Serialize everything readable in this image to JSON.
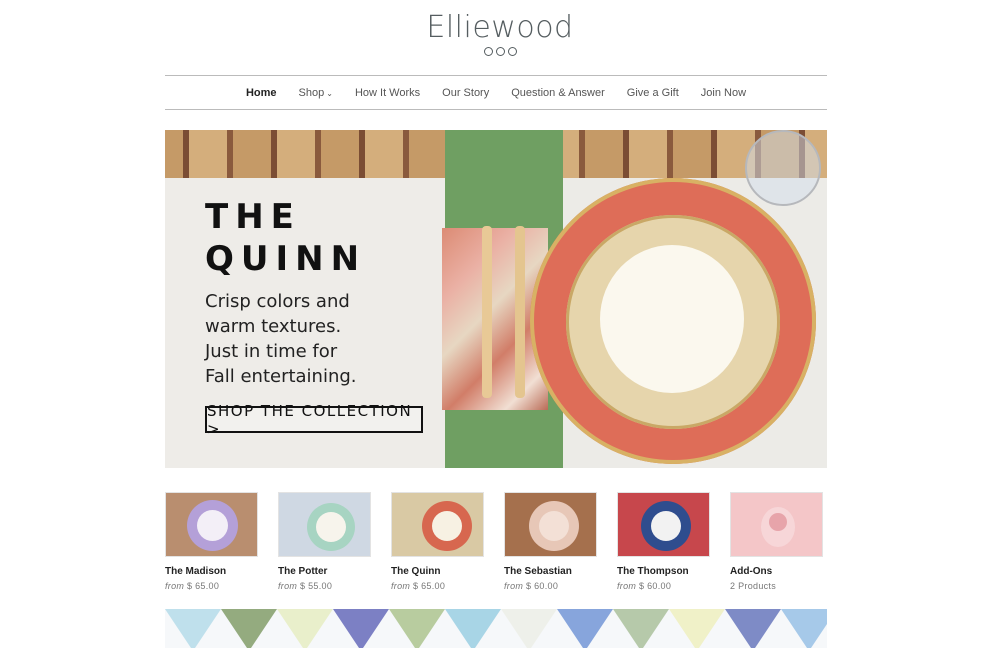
{
  "brand": {
    "name": "Elliewood"
  },
  "nav": {
    "items": [
      {
        "label": "Home",
        "active": true
      },
      {
        "label": "Shop",
        "dropdown": true
      },
      {
        "label": "How It Works"
      },
      {
        "label": "Our Story"
      },
      {
        "label": "Question & Answer"
      },
      {
        "label": "Give a Gift"
      },
      {
        "label": "Join Now"
      }
    ]
  },
  "hero": {
    "title_line1": "THE",
    "title_line2": "QUINN",
    "tagline_line1": "Crisp colors and",
    "tagline_line2": "warm textures.",
    "tagline_line3": "Just in time for",
    "tagline_line4": "Fall entertaining.",
    "cta": "SHOP THE COLLECTION >"
  },
  "products": [
    {
      "name": "The Madison",
      "from": "from",
      "price": "$ 65.00",
      "colors": {
        "bg": "#b98e6f",
        "plate": "#b4a0d8",
        "inner": "#f3eff7"
      }
    },
    {
      "name": "The Potter",
      "from": "from",
      "price": "$ 55.00",
      "colors": {
        "bg": "#cfd8e3",
        "plate": "#a7d4c2",
        "inner": "#f7f4ec"
      }
    },
    {
      "name": "The Quinn",
      "from": "from",
      "price": "$ 65.00",
      "colors": {
        "bg": "#d9c9a4",
        "plate": "#d7674f",
        "inner": "#f7f1e3"
      }
    },
    {
      "name": "The Sebastian",
      "from": "from",
      "price": "$ 60.00",
      "colors": {
        "bg": "#a5704d",
        "plate": "#e7c7b7",
        "inner": "#f3e0d6"
      }
    },
    {
      "name": "The Thompson",
      "from": "from",
      "price": "$ 60.00",
      "colors": {
        "bg": "#c7474c",
        "plate": "#2f4d8e",
        "inner": "#f2f2f2"
      }
    },
    {
      "name": "Add-Ons",
      "count": "2 Products",
      "colors": {
        "bg": "#f4c6c8",
        "plate": "#f7d6d8",
        "inner": "#e7a4aa"
      }
    }
  ],
  "bunting_colors": [
    "#bfe0ec",
    "#94ab7f",
    "#e9efcb",
    "#7c80c4",
    "#b8cc9f",
    "#a8d5e6",
    "#eef0ea",
    "#87a5dc",
    "#b6c9aa",
    "#f0f1c8",
    "#7e8bc6",
    "#a6c9e9"
  ]
}
